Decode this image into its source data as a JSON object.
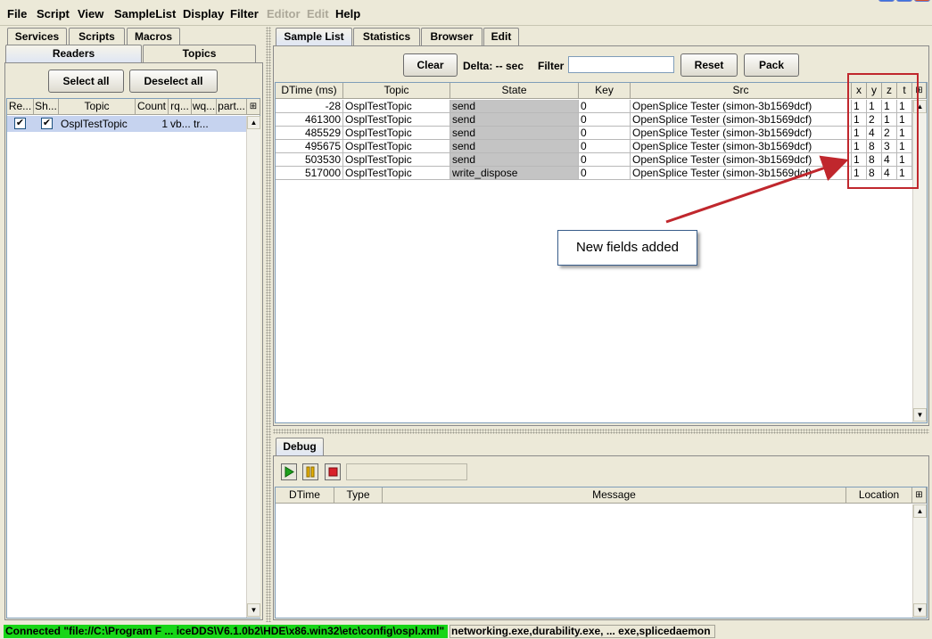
{
  "menu": {
    "file": "File",
    "script": "Script",
    "view": "View",
    "samplelist": "SampleList",
    "display": "Display",
    "filter": "Filter",
    "editor": "Editor",
    "edit": "Edit",
    "help": "Help"
  },
  "left": {
    "tabs_top": [
      "Services",
      "Scripts",
      "Macros"
    ],
    "tabs_second": [
      "Readers",
      "Topics"
    ],
    "select_all": "Select all",
    "deselect_all": "Deselect all",
    "columns": [
      "Re...",
      "Sh...",
      "Topic",
      "Count",
      "rq...",
      "wq...",
      "part..."
    ],
    "row": {
      "re": "✔",
      "sh": "✔",
      "topic": "OsplTestTopic",
      "count": "1",
      "rq": "vb...",
      "wq": "tr...",
      "part": ""
    }
  },
  "right": {
    "tabs": [
      "Sample List",
      "Statistics",
      "Browser",
      "Edit"
    ],
    "clear": "Clear",
    "delta": "Delta: -- sec",
    "filter_label": "Filter",
    "filter_value": "",
    "reset": "Reset",
    "pack": "Pack",
    "columns": [
      "DTime (ms)",
      "Topic",
      "State",
      "Key",
      "Src",
      "x",
      "y",
      "z",
      "t"
    ],
    "rows": [
      {
        "dtime": "-28",
        "topic": "OsplTestTopic",
        "state": "send",
        "key": "0",
        "src": "OpenSplice Tester (simon-3b1569dcf)",
        "x": "1",
        "y": "1",
        "z": "1",
        "t": "1"
      },
      {
        "dtime": "461300",
        "topic": "OsplTestTopic",
        "state": "send",
        "key": "0",
        "src": "OpenSplice Tester (simon-3b1569dcf)",
        "x": "1",
        "y": "2",
        "z": "1",
        "t": "1"
      },
      {
        "dtime": "485529",
        "topic": "OsplTestTopic",
        "state": "send",
        "key": "0",
        "src": "OpenSplice Tester (simon-3b1569dcf)",
        "x": "1",
        "y": "4",
        "z": "2",
        "t": "1"
      },
      {
        "dtime": "495675",
        "topic": "OsplTestTopic",
        "state": "send",
        "key": "0",
        "src": "OpenSplice Tester (simon-3b1569dcf)",
        "x": "1",
        "y": "8",
        "z": "3",
        "t": "1"
      },
      {
        "dtime": "503530",
        "topic": "OsplTestTopic",
        "state": "send",
        "key": "0",
        "src": "OpenSplice Tester (simon-3b1569dcf)",
        "x": "1",
        "y": "8",
        "z": "4",
        "t": "1"
      },
      {
        "dtime": "517000",
        "topic": "OsplTestTopic",
        "state": "write_dispose",
        "key": "0",
        "src": "OpenSplice Tester (simon-3b1569dcf)",
        "x": "1",
        "y": "8",
        "z": "4",
        "t": "1"
      }
    ],
    "annotation": "New fields added"
  },
  "debug": {
    "tab": "Debug",
    "columns": [
      "DTime",
      "Type",
      "Message",
      "Location"
    ]
  },
  "status": {
    "left": "Connected \"file://C:\\Program F ... iceDDS\\V6.1.0b2\\HDE\\x86.win32\\etc\\config\\ospl.xml\"",
    "right": "networking.exe,durability.exe, ... exe,splicedaemon"
  },
  "colors": {
    "status_ok": "#17d617",
    "annotation_red": "#c0272d",
    "selected_row": "#c6d3ef"
  }
}
